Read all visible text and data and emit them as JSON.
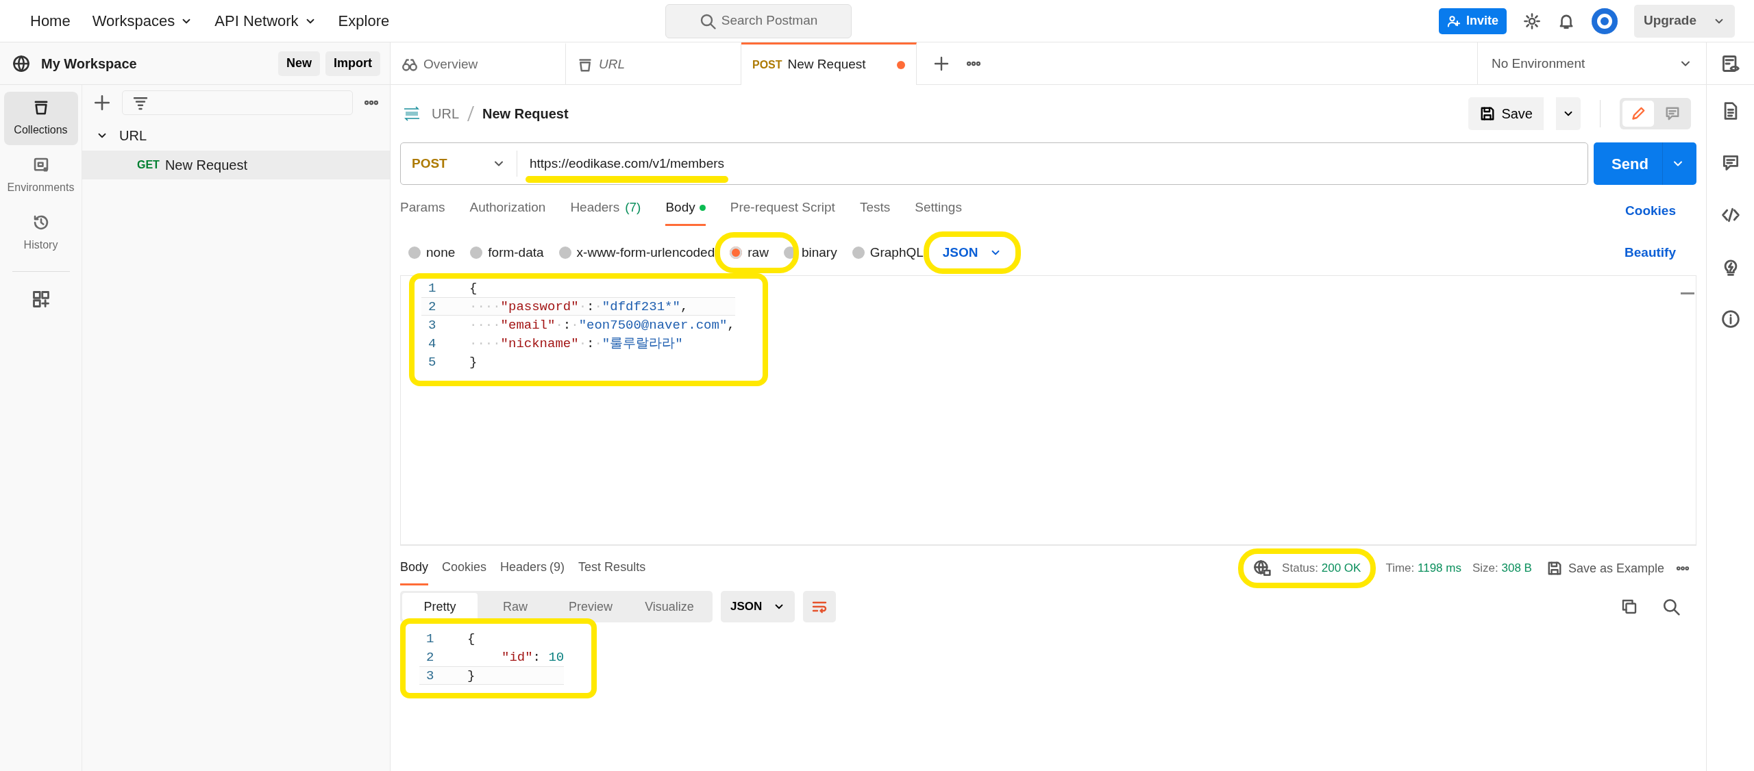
{
  "top_nav": {
    "items": [
      {
        "label": "Home",
        "dropdown": false
      },
      {
        "label": "Workspaces",
        "dropdown": true
      },
      {
        "label": "API Network",
        "dropdown": true
      },
      {
        "label": "Explore",
        "dropdown": false
      }
    ],
    "search_placeholder": "Search Postman",
    "invite": "Invite",
    "upgrade": "Upgrade"
  },
  "workspace": {
    "name": "My Workspace",
    "buttons": [
      "New",
      "Import"
    ]
  },
  "sidebar": {
    "items": [
      {
        "label": "Collections",
        "selected": true
      },
      {
        "label": "Environments",
        "selected": false
      },
      {
        "label": "History",
        "selected": false
      }
    ]
  },
  "tree": [
    {
      "label": "URL",
      "expanded": true,
      "children": [
        {
          "method": "GET",
          "label": "New Request",
          "selected": true
        }
      ]
    }
  ],
  "tabs": [
    {
      "label": "Overview",
      "preview": false,
      "selected": false,
      "unsaved": false
    },
    {
      "label": "URL",
      "preview": true,
      "selected": false,
      "unsaved": false
    },
    {
      "method": "POST",
      "label": "New Request",
      "preview": false,
      "selected": true,
      "unsaved": true
    }
  ],
  "environment": "No Environment",
  "breadcrumb": [
    "URL",
    "New Request"
  ],
  "save": "Save",
  "request": {
    "method": "POST",
    "url": "https://eodikase.com/v1/members",
    "highlighted": true,
    "send": "Send"
  },
  "request_tabs": [
    {
      "label": "Params",
      "selected": false
    },
    {
      "label": "Authorization",
      "selected": false
    },
    {
      "label": "Headers",
      "count": "(7)",
      "selected": false
    },
    {
      "label": "Body",
      "selected": true,
      "dot": true
    },
    {
      "label": "Pre-request Script",
      "selected": false
    },
    {
      "label": "Tests",
      "selected": false
    },
    {
      "label": "Settings",
      "selected": false
    }
  ],
  "cookies_link": "Cookies",
  "body_types": [
    {
      "label": "none",
      "selected": false,
      "highlighted": false
    },
    {
      "label": "form-data",
      "selected": false,
      "highlighted": false
    },
    {
      "label": "x-www-form-urlencoded",
      "selected": false,
      "highlighted": false
    },
    {
      "label": "raw",
      "selected": true,
      "highlighted": true
    },
    {
      "label": "binary",
      "selected": false,
      "highlighted": false
    },
    {
      "label": "GraphQL",
      "selected": false,
      "highlighted": false
    }
  ],
  "body_format": {
    "label": "JSON",
    "highlighted": true
  },
  "beautify": "Beautify",
  "request_body": {
    "highlighted": true,
    "lines": [
      {
        "number": "1",
        "active": false,
        "tokens": [
          {
            "kind": "punct",
            "text": "{"
          }
        ]
      },
      {
        "number": "2",
        "active": true,
        "tokens": [
          {
            "kind": "ws",
            "text": "····"
          },
          {
            "kind": "key",
            "text": "\"password\""
          },
          {
            "kind": "ws",
            "text": "·"
          },
          {
            "kind": "punct",
            "text": ":"
          },
          {
            "kind": "ws",
            "text": "·"
          },
          {
            "kind": "string",
            "text": "\"dfdf231*\""
          },
          {
            "kind": "punct",
            "text": ","
          }
        ]
      },
      {
        "number": "3",
        "active": false,
        "tokens": [
          {
            "kind": "ws",
            "text": "····"
          },
          {
            "kind": "key",
            "text": "\"email\""
          },
          {
            "kind": "ws",
            "text": "·"
          },
          {
            "kind": "punct",
            "text": ":"
          },
          {
            "kind": "ws",
            "text": "·"
          },
          {
            "kind": "string",
            "text": "\"eon7500@naver.com\""
          },
          {
            "kind": "punct",
            "text": ","
          }
        ]
      },
      {
        "number": "4",
        "active": false,
        "tokens": [
          {
            "kind": "ws",
            "text": "····"
          },
          {
            "kind": "key",
            "text": "\"nickname\""
          },
          {
            "kind": "ws",
            "text": "·"
          },
          {
            "kind": "punct",
            "text": ":"
          },
          {
            "kind": "ws",
            "text": "·"
          },
          {
            "kind": "string",
            "text": "\"룰루랄라라\""
          }
        ]
      },
      {
        "number": "5",
        "active": false,
        "tokens": [
          {
            "kind": "punct",
            "text": "}"
          }
        ]
      }
    ]
  },
  "response": {
    "tabs": [
      {
        "label": "Body",
        "selected": true
      },
      {
        "label": "Cookies",
        "selected": false
      },
      {
        "label": "Headers",
        "count": "(9)",
        "selected": false
      },
      {
        "label": "Test Results",
        "selected": false
      }
    ],
    "status": {
      "label": "Status:",
      "value": "200 OK",
      "highlighted": true
    },
    "time": {
      "label": "Time:",
      "value": "1198 ms"
    },
    "size": {
      "label": "Size:",
      "value": "308 B"
    },
    "save_example": "Save as Example",
    "views": [
      {
        "label": "Pretty",
        "selected": true
      },
      {
        "label": "Raw",
        "selected": false
      },
      {
        "label": "Preview",
        "selected": false
      },
      {
        "label": "Visualize",
        "selected": false
      }
    ],
    "format": "JSON",
    "body": {
      "highlighted": true,
      "lines": [
        {
          "number": "1",
          "active": false,
          "tokens": [
            {
              "kind": "punct",
              "text": "{"
            }
          ]
        },
        {
          "number": "2",
          "active": false,
          "indented": true,
          "tokens": [
            {
              "kind": "key",
              "text": "\"id\""
            },
            {
              "kind": "punct",
              "text": ": "
            },
            {
              "kind": "number",
              "text": "10"
            }
          ]
        },
        {
          "number": "3",
          "active": true,
          "tokens": [
            {
              "kind": "punct",
              "text": "}"
            }
          ]
        }
      ]
    }
  }
}
